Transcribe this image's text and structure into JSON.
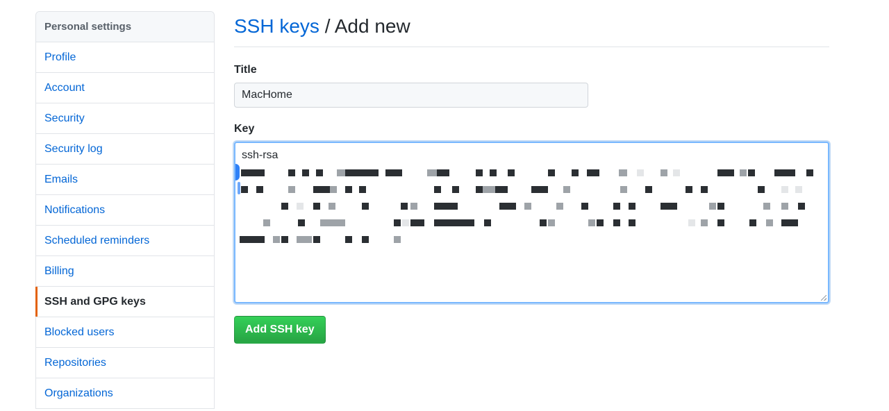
{
  "sidebar": {
    "header": "Personal settings",
    "items": [
      {
        "label": "Profile",
        "selected": false
      },
      {
        "label": "Account",
        "selected": false
      },
      {
        "label": "Security",
        "selected": false
      },
      {
        "label": "Security log",
        "selected": false
      },
      {
        "label": "Emails",
        "selected": false
      },
      {
        "label": "Notifications",
        "selected": false
      },
      {
        "label": "Scheduled reminders",
        "selected": false
      },
      {
        "label": "Billing",
        "selected": false
      },
      {
        "label": "SSH and GPG keys",
        "selected": true
      },
      {
        "label": "Blocked users",
        "selected": false
      },
      {
        "label": "Repositories",
        "selected": false
      },
      {
        "label": "Organizations",
        "selected": false
      }
    ]
  },
  "main": {
    "breadcrumb_link": "SSH keys",
    "breadcrumb_separator": " / ",
    "breadcrumb_current": "Add new",
    "title_label": "Title",
    "title_value": "MacHome",
    "key_label": "Key",
    "key_value_visible": "ssh-rsa",
    "submit_label": "Add SSH key"
  },
  "colors": {
    "link": "#0366d6",
    "selected_indicator": "#e36209",
    "button_green": "#2ea44f",
    "focus_border": "#79b8ff",
    "border": "#e1e4e8"
  },
  "icons": [
    "text-cursor-handle-icon",
    "resize-grip-icon"
  ]
}
